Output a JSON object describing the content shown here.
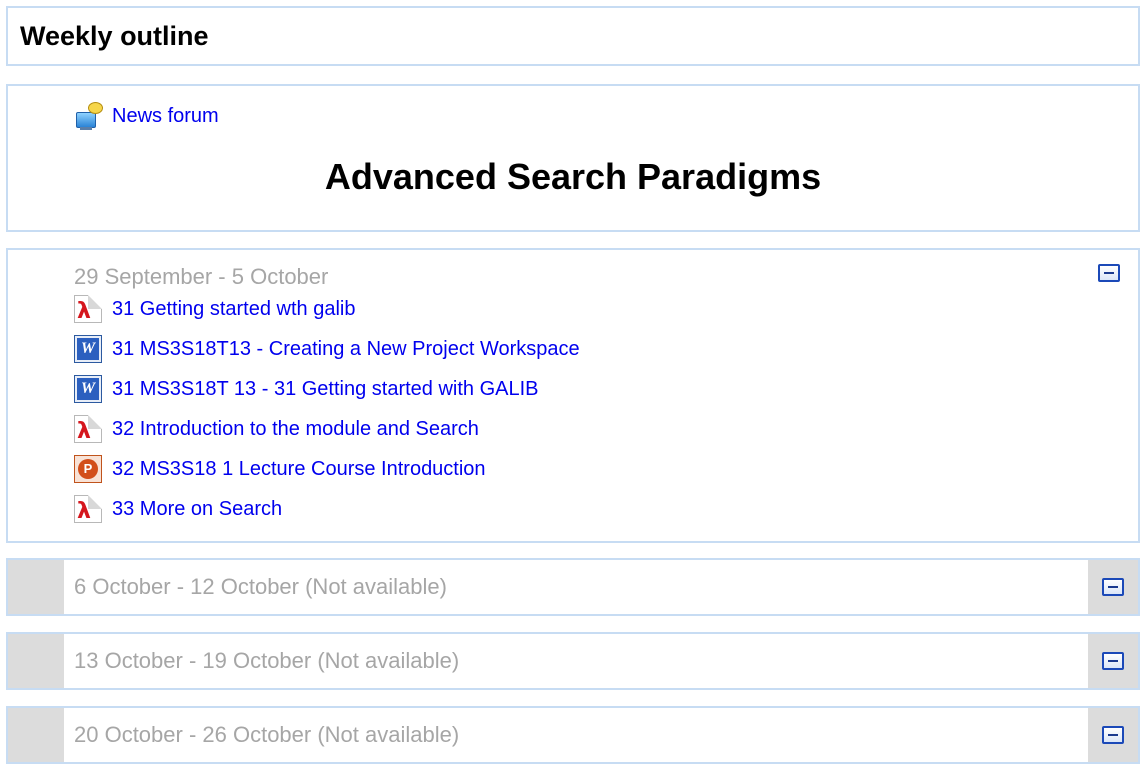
{
  "outline": {
    "title": "Weekly outline"
  },
  "section0": {
    "news_forum": "News forum",
    "course_heading": "Advanced Search Paradigms"
  },
  "week1": {
    "title": "29 September - 5 October",
    "items": [
      {
        "label": "31 Getting started wth galib",
        "icon": "pdf-icon"
      },
      {
        "label": "31 MS3S18T13 - Creating a New Project Workspace",
        "icon": "word-icon"
      },
      {
        "label": "31 MS3S18T 13 - 31 Getting started with GALIB",
        "icon": "word-icon"
      },
      {
        "label": "32 Introduction to the module and Search",
        "icon": "pdf-icon"
      },
      {
        "label": "32 MS3S18 1 Lecture Course Introduction",
        "icon": "powerpoint-icon"
      },
      {
        "label": "33 More on Search",
        "icon": "pdf-icon"
      }
    ]
  },
  "hidden_weeks": [
    {
      "title": "6 October - 12 October (Not available)"
    },
    {
      "title": "13 October - 19 October (Not available)"
    },
    {
      "title": "20 October - 26 October (Not available)"
    }
  ],
  "colors": {
    "link": "#0000ee",
    "muted_title": "#a6a6a6",
    "border": "#c7dcf3",
    "hidden_band": "#dcdcdc"
  }
}
